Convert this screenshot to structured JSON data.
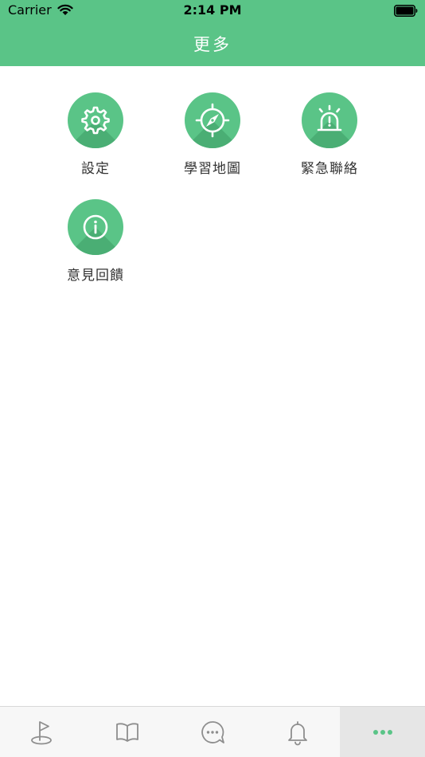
{
  "status_bar": {
    "carrier": "Carrier",
    "time": "2:14 PM"
  },
  "nav": {
    "title": "更多"
  },
  "menu": [
    {
      "label": "設定",
      "icon": "gear-icon"
    },
    {
      "label": "學習地圖",
      "icon": "compass-icon"
    },
    {
      "label": "緊急聯絡",
      "icon": "alarm-siren-icon"
    },
    {
      "label": "意見回饋",
      "icon": "info-icon"
    }
  ],
  "tab_bar": {
    "tabs": [
      {
        "icon": "golf-flag-icon",
        "active": false
      },
      {
        "icon": "open-book-icon",
        "active": false
      },
      {
        "icon": "chat-bubble-icon",
        "active": false
      },
      {
        "icon": "bell-icon",
        "active": false
      },
      {
        "icon": "more-dots-icon",
        "active": true
      }
    ]
  },
  "colors": {
    "brand_green": "#5ac487",
    "icon_shadow_green": "#4aae74",
    "tab_icon_gray": "#8e8e8e",
    "tab_active_background": "#e6e6e6"
  }
}
